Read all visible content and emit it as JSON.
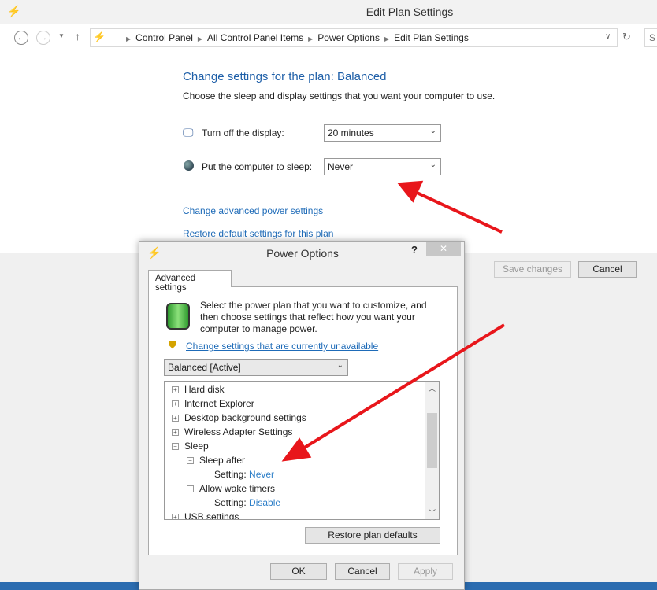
{
  "window": {
    "title": "Edit Plan Settings",
    "icon": "power-options-icon"
  },
  "address": {
    "crumbs": [
      "Control Panel",
      "All Control Panel Items",
      "Power Options",
      "Edit Plan Settings"
    ],
    "search_partial": "S"
  },
  "main": {
    "heading": "Change settings for the plan: Balanced",
    "subtitle": "Choose the sleep and display settings that you want your computer to use.",
    "display_label": "Turn off the display:",
    "display_value": "20 minutes",
    "sleep_label": "Put the computer to sleep:",
    "sleep_value": "Never",
    "advanced_link": "Change advanced power settings",
    "restore_link": "Restore default settings for this plan",
    "save": "Save changes",
    "cancel": "Cancel"
  },
  "dialog": {
    "title": "Power Options",
    "help": "?",
    "close": "✕",
    "tab": "Advanced settings",
    "description": "Select the power plan that you want to customize, and then choose settings that reflect how you want your computer to manage power.",
    "unavailable_link": "Change settings that are currently unavailable",
    "plan": "Balanced [Active]",
    "tree": [
      {
        "label": "Hard disk",
        "expander": "+"
      },
      {
        "label": "Internet Explorer",
        "expander": "+"
      },
      {
        "label": "Desktop background settings",
        "expander": "+"
      },
      {
        "label": "Wireless Adapter Settings",
        "expander": "+"
      },
      {
        "label": "Sleep",
        "expander": "−"
      },
      {
        "label": "Sleep after",
        "expander": "−"
      },
      {
        "label": "Setting:",
        "value": "Never"
      },
      {
        "label": "Allow wake timers",
        "expander": "−"
      },
      {
        "label": "Setting:",
        "value": "Disable"
      },
      {
        "label": "USB settings",
        "expander": "+"
      }
    ],
    "restore": "Restore plan defaults",
    "ok": "OK",
    "cancel": "Cancel",
    "apply": "Apply"
  },
  "colors": {
    "accent": "#1e6bb8",
    "arrow": "#e8161b"
  }
}
